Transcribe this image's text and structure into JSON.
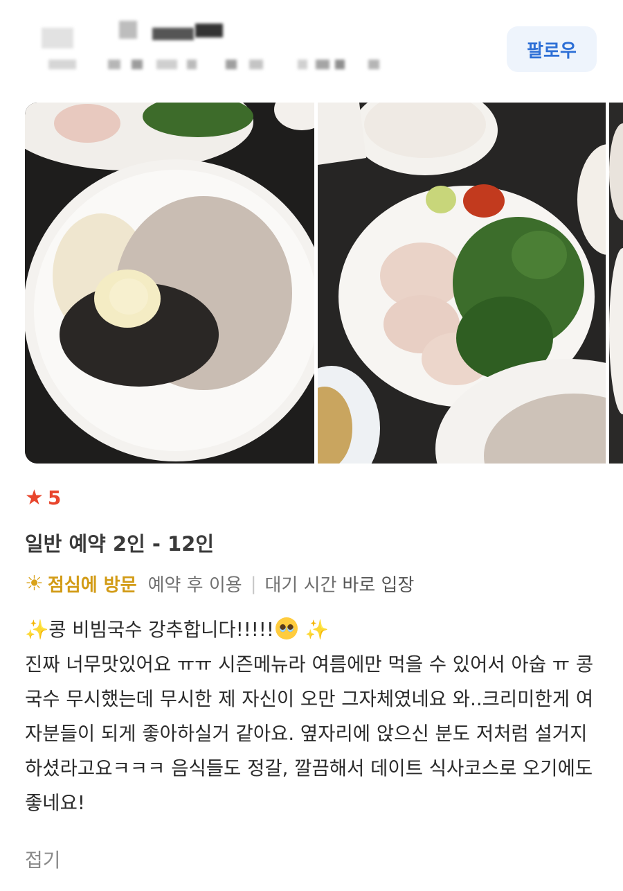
{
  "header": {
    "follow_label": "팔로우"
  },
  "rating": {
    "icon": "star-icon",
    "score": "5",
    "color": "#e8452c"
  },
  "reservation": "일반 예약 2인 - 12인",
  "tags": {
    "icon": "sun-icon",
    "visit": "점심에 방문",
    "reserve_use": "예약 후 이용",
    "wait_label": "대기 시간",
    "wait_value": "바로 입장"
  },
  "review": {
    "headline_text": "콩 비빔국수 강추합니다!!!!!",
    "body": "진짜 너무맛있어요 ㅠㅠ 시즌메뉴라 여름에만 먹을 수 있어서 아숩 ㅠ 콩국수 무시했는데 무시한 제 자신이 오만 그자체였네요 와..크리미한게 여자분들이 되게 좋아하실거 같아요. 옆자리에 앉으신 분도 저처럼 설거지 하셨라고요ㅋㅋㅋ 음식들도 정갈, 깔끔해서 데이트 식사코스로 오기에도 좋네요!"
  },
  "collapse_label": "접기"
}
